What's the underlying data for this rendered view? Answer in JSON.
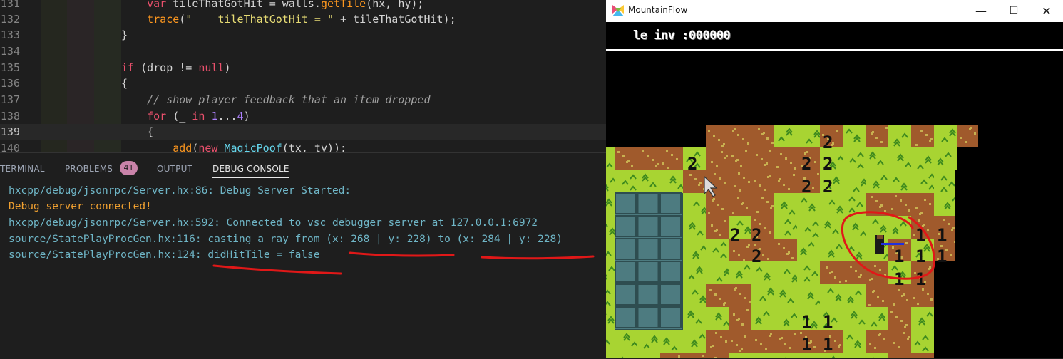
{
  "editor": {
    "lines": [
      {
        "num": "131",
        "tokens": [
          [
            "",
            "    "
          ],
          [
            "kw",
            "var"
          ],
          [
            "",
            " tileThatGotHit = walls."
          ],
          [
            "fn",
            "getTile"
          ],
          [
            "",
            "(hx, hy);"
          ]
        ]
      },
      {
        "num": "132",
        "tokens": [
          [
            "",
            "    "
          ],
          [
            "fn",
            "trace"
          ],
          [
            "",
            "("
          ],
          [
            "str",
            "\"    tileThatGotHit = \""
          ],
          [
            "",
            " + tileThatGotHit);"
          ]
        ]
      },
      {
        "num": "133",
        "tokens": [
          [
            "",
            "}"
          ]
        ]
      },
      {
        "num": "134",
        "tokens": []
      },
      {
        "num": "135",
        "tokens": [
          [
            "kw",
            "if"
          ],
          [
            "",
            " (drop != "
          ],
          [
            "kw",
            "null"
          ],
          [
            "",
            ")"
          ]
        ]
      },
      {
        "num": "136",
        "tokens": [
          [
            "",
            "{"
          ]
        ]
      },
      {
        "num": "137",
        "tokens": [
          [
            "",
            "    "
          ],
          [
            "cmt",
            "// show player feedback that an item dropped"
          ]
        ]
      },
      {
        "num": "138",
        "tokens": [
          [
            "",
            "    "
          ],
          [
            "kw",
            "for"
          ],
          [
            "",
            " (_ "
          ],
          [
            "kw",
            "in"
          ],
          [
            "",
            " "
          ],
          [
            "num",
            "1"
          ],
          [
            "",
            "..."
          ],
          [
            "num",
            "4"
          ],
          [
            "",
            ")"
          ]
        ]
      },
      {
        "num": "139",
        "tokens": [
          [
            "",
            "    {"
          ]
        ]
      },
      {
        "num": "140",
        "tokens": [
          [
            "",
            "        "
          ],
          [
            "fn",
            "add"
          ],
          [
            "",
            "("
          ],
          [
            "kw",
            "new"
          ],
          [
            "",
            " "
          ],
          [
            "cls",
            "MagicPoof"
          ],
          [
            "",
            "(tx, ty));"
          ]
        ]
      }
    ],
    "current_line": "139"
  },
  "panel": {
    "tabs": [
      {
        "label": "TERMINAL",
        "active": false
      },
      {
        "label": "PROBLEMS",
        "active": false
      },
      {
        "label": "OUTPUT",
        "active": false
      },
      {
        "label": "DEBUG CONSOLE",
        "active": true
      }
    ],
    "problems_count": "41",
    "console": [
      {
        "text": "hxcpp/debug/jsonrpc/Server.hx:86: Debug Server Started:",
        "color": "blue"
      },
      {
        "text": "Debug server connected!",
        "color": "orange"
      },
      {
        "text": "hxcpp/debug/jsonrpc/Server.hx:592: Connected to vsc debugger server at 127.0.0.1:6972",
        "color": "blue"
      },
      {
        "text": "source/StatePlayProcGen.hx:116: casting a ray from (x: 268 | y: 228) to (x: 284 | y: 228)",
        "color": "blue"
      },
      {
        "text": "source/StatePlayProcGen.hx:124: didHitTile = false",
        "color": "blue"
      }
    ]
  },
  "game": {
    "window_title": "MountainFlow",
    "minimize_glyph": "—",
    "maximize_glyph": "☐",
    "close_glyph": "✕",
    "hud_text": "le inv :000000",
    "colors": {
      "grass": "#a8d432",
      "grass_mark": "#3e8a1e",
      "dirt": "#a05a2c",
      "dirt_mark": "#c8b050",
      "water": "#4d7b80",
      "annotation": "#e01818"
    }
  }
}
